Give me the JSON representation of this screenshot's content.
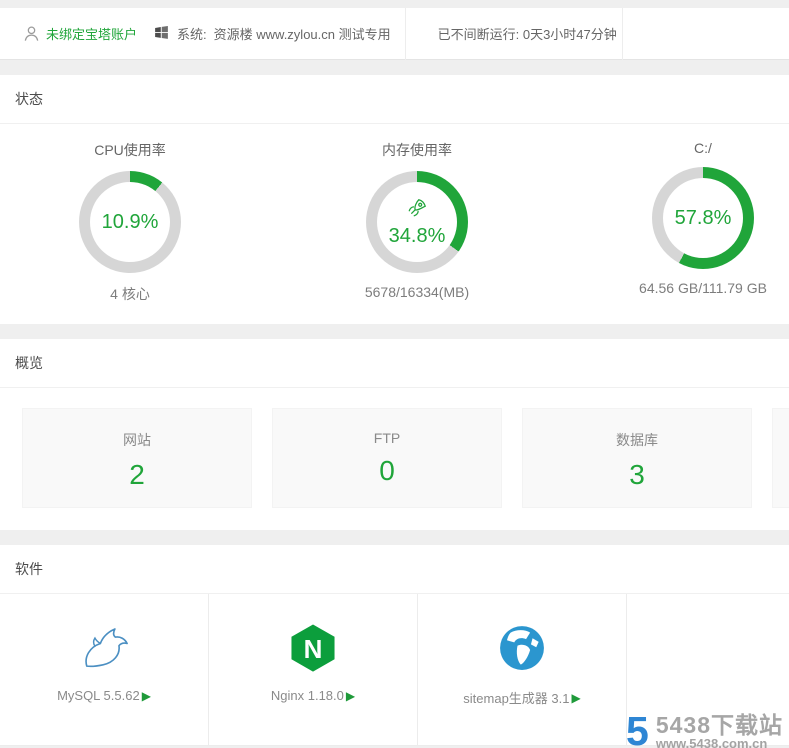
{
  "colors": {
    "green": "#20a53a",
    "ring": "#d6d6d6"
  },
  "topbar": {
    "account_label": "未绑定宝塔账户",
    "system_label": "系统:",
    "system_value": "资源楼 www.zylou.cn 测试专用",
    "uptime_label": "已不间断运行: 0天3小时47分钟"
  },
  "status": {
    "title": "状态",
    "gauges": [
      {
        "title": "CPU使用率",
        "percent": 10.9,
        "percent_label": "10.9%",
        "detail": "4 核心"
      },
      {
        "title": "内存使用率",
        "percent": 34.8,
        "percent_label": "34.8%",
        "detail": "5678/16334(MB)"
      },
      {
        "title": "C:/",
        "percent": 57.8,
        "percent_label": "57.8%",
        "detail": "64.56 GB/111.79 GB"
      }
    ]
  },
  "overview": {
    "title": "概览",
    "cards": [
      {
        "label": "网站",
        "value": "2"
      },
      {
        "label": "FTP",
        "value": "0"
      },
      {
        "label": "数据库",
        "value": "3"
      }
    ]
  },
  "software": {
    "title": "软件",
    "nginx_letter": "N",
    "play_glyph": "▶",
    "items": [
      {
        "label": "MySQL 5.5.62"
      },
      {
        "label": "Nginx 1.18.0"
      },
      {
        "label": "sitemap生成器 3.1"
      }
    ]
  },
  "watermark": {
    "logo_text": "5",
    "site_name": "5438下载站",
    "site_url": "www.5438.com.cn"
  }
}
